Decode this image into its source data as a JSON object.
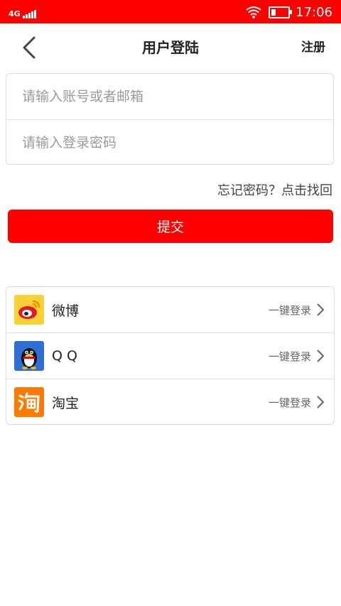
{
  "status": {
    "network": "4G",
    "time": "17:06"
  },
  "header": {
    "title": "用户登陆",
    "register_label": "注册"
  },
  "form": {
    "account_placeholder": "请输入账号或者邮箱",
    "password_placeholder": "请输入登录密码",
    "forgot_label": "忘记密码？点击找回",
    "submit_label": "提交"
  },
  "social": {
    "items": [
      {
        "name": "微博",
        "action": "一键登录"
      },
      {
        "name": "Q Q",
        "action": "一键登录"
      },
      {
        "name": "淘宝",
        "action": "一键登录"
      }
    ]
  },
  "colors": {
    "accent": "#ff0000",
    "taobao": "#ff7a00",
    "qq": "#2f6fd3"
  }
}
